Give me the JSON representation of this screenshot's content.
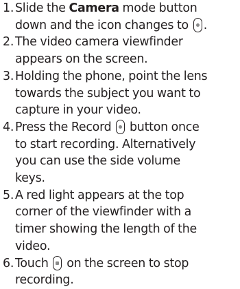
{
  "steps": [
    {
      "number": "1.",
      "lines": [
        {
          "before": "Slide the ",
          "bold": "Camera",
          "after": " mode button"
        },
        {
          "before": "down and the icon changes to ",
          "icon": "record-icon",
          "after": "."
        }
      ]
    },
    {
      "number": "2.",
      "lines": [
        {
          "text": "The video camera viewfinder"
        },
        {
          "text": "appears on the screen."
        }
      ]
    },
    {
      "number": "3.",
      "lines": [
        {
          "text": "Holding the phone, point the lens"
        },
        {
          "text": "towards the subject you want to"
        },
        {
          "text": "capture in your video."
        }
      ]
    },
    {
      "number": "4.",
      "lines": [
        {
          "before": "Press the Record ",
          "icon": "record-icon",
          "after": " button once"
        },
        {
          "text": "to start recording. Alternatively"
        },
        {
          "text": "you can use the side volume"
        },
        {
          "text": "keys."
        }
      ]
    },
    {
      "number": "5.",
      "lines": [
        {
          "text": "A red light appears at the top"
        },
        {
          "text": "corner of the viewfinder with a"
        },
        {
          "text": "timer showing the length of the"
        },
        {
          "text": "video."
        }
      ]
    },
    {
      "number": "6.",
      "lines": [
        {
          "before": "Touch ",
          "icon": "stop-icon",
          "after": " on the screen to stop"
        },
        {
          "text": "recording."
        }
      ]
    }
  ]
}
